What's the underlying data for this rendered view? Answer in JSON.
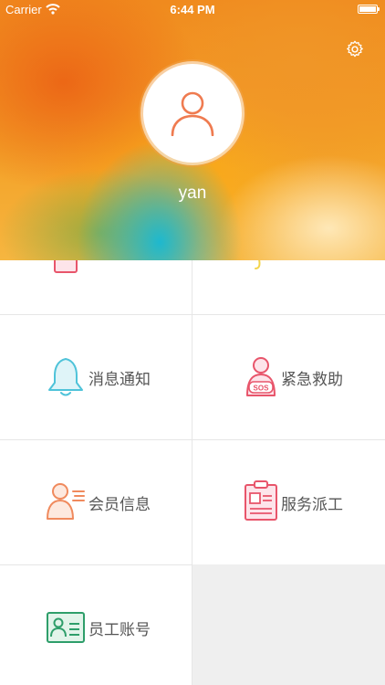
{
  "status_bar": {
    "carrier": "Carrier",
    "time": "6:44 PM"
  },
  "profile": {
    "username": "yan",
    "avatar_icon": "user-outline-icon",
    "settings_icon": "gear-icon"
  },
  "menu": {
    "items": [
      {
        "label": "消息通知",
        "icon": "bell-icon",
        "color": "#4fc3d9"
      },
      {
        "label": "紧急救助",
        "icon": "sos-person-icon",
        "color": "#e8556b"
      },
      {
        "label": "会员信息",
        "icon": "member-icon",
        "color": "#f08a5d"
      },
      {
        "label": "服务派工",
        "icon": "clipboard-icon",
        "color": "#e8556b"
      },
      {
        "label": "员工账号",
        "icon": "id-card-icon",
        "color": "#2e9e6a"
      }
    ]
  },
  "colors": {
    "accent_orange": "#f08a1e",
    "label_text": "#555555",
    "divider": "#e6e6e6"
  }
}
